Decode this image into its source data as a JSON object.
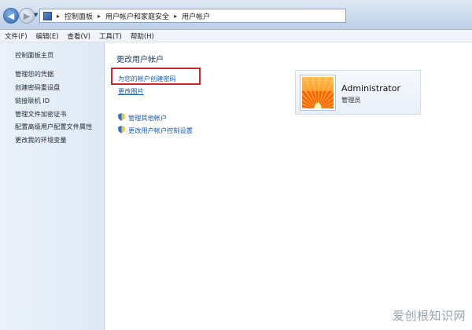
{
  "address_bar": {
    "breadcrumbs": [
      "控制面板",
      "用户帐户和家庭安全",
      "用户帐户"
    ],
    "separator": "▸"
  },
  "menu": [
    "文件(F)",
    "编辑(E)",
    "查看(V)",
    "工具(T)",
    "帮助(H)"
  ],
  "sidebar": {
    "items": [
      {
        "label": "控制面板主页",
        "icon": null
      },
      {
        "label": "管理您的凭据",
        "icon": null
      },
      {
        "label": "创建密码重设盘",
        "icon": null
      },
      {
        "label": "链接联机 ID",
        "icon": null
      },
      {
        "label": "管理文件加密证书",
        "icon": null
      },
      {
        "label": "配置高级用户配置文件属性",
        "icon": null
      },
      {
        "label": "更改我的环境变量",
        "icon": null
      }
    ]
  },
  "main": {
    "title": "更改用户帐户",
    "links": [
      {
        "label": "为您的帐户创建密码",
        "highlighted": true
      },
      {
        "label": "更改图片",
        "highlighted": false
      }
    ],
    "shield_links": [
      {
        "label": "管理其他帐户",
        "icon": "uac-shield-icon"
      },
      {
        "label": "更改用户帐户控制设置",
        "icon": "uac-shield-icon"
      }
    ]
  },
  "user": {
    "name": "Administrator",
    "role": "管理员",
    "picture": "flower-picture"
  },
  "watermark": "爱创根知识网",
  "colors": {
    "link": "#1a5fb4",
    "highlight_box": "#c8262b",
    "sidebar_bg": "#e4edf8"
  }
}
